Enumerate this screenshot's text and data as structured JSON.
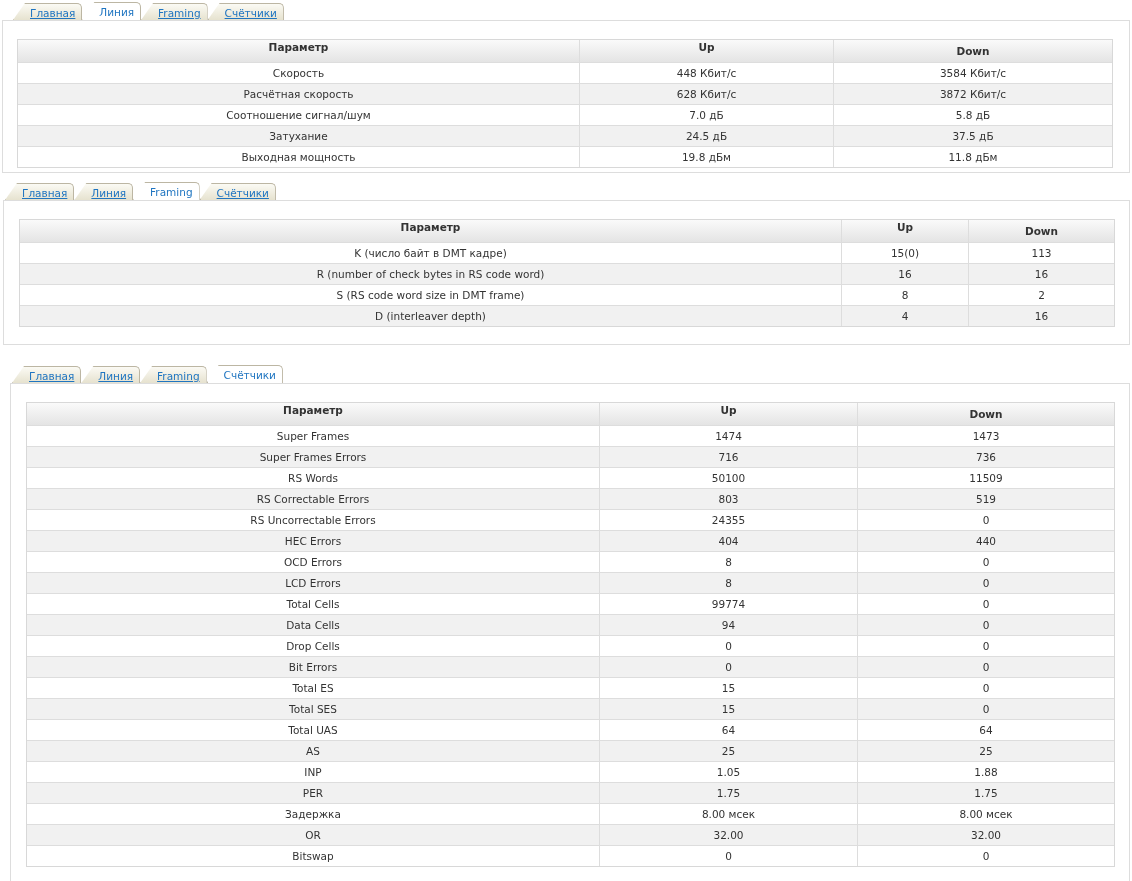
{
  "panels": [
    {
      "tabs": [
        {
          "label": "Главная",
          "selected": false
        },
        {
          "label": "Линия",
          "selected": true
        },
        {
          "label": "Framing",
          "selected": false
        },
        {
          "label": "Счётчики",
          "selected": false
        }
      ],
      "columns": [
        "Параметр",
        "Up",
        "Down"
      ],
      "rows": [
        [
          "Скорость",
          "448 Кбит/с",
          "3584 Кбит/с"
        ],
        [
          "Расчётная скорость",
          "628 Кбит/с",
          "3872 Кбит/с"
        ],
        [
          "Соотношение сигнал/шум",
          "7.0 дБ",
          "5.8 дБ"
        ],
        [
          "Затухание",
          "24.5 дБ",
          "37.5 дБ"
        ],
        [
          "Выходная мощность",
          "19.8 дБм",
          "11.8 дБм"
        ]
      ]
    },
    {
      "tabs": [
        {
          "label": "Главная",
          "selected": false
        },
        {
          "label": "Линия",
          "selected": false
        },
        {
          "label": "Framing",
          "selected": true
        },
        {
          "label": "Счётчики",
          "selected": false
        }
      ],
      "columns": [
        "Параметр",
        "Up",
        "Down"
      ],
      "rows": [
        [
          "K (число байт в DMT кадре)",
          "15(0)",
          "113"
        ],
        [
          "R (number of check bytes in RS code word)",
          "16",
          "16"
        ],
        [
          "S (RS code word size in DMT frame)",
          "8",
          "2"
        ],
        [
          "D (interleaver depth)",
          "4",
          "16"
        ]
      ]
    },
    {
      "tabs": [
        {
          "label": "Главная",
          "selected": false
        },
        {
          "label": "Линия",
          "selected": false
        },
        {
          "label": "Framing",
          "selected": false
        },
        {
          "label": "Счётчики",
          "selected": true
        }
      ],
      "columns": [
        "Параметр",
        "Up",
        "Down"
      ],
      "rows": [
        [
          "Super Frames",
          "1474",
          "1473"
        ],
        [
          "Super Frames Errors",
          "716",
          "736"
        ],
        [
          "RS Words",
          "50100",
          "11509"
        ],
        [
          "RS Correctable Errors",
          "803",
          "519"
        ],
        [
          "RS Uncorrectable Errors",
          "24355",
          "0"
        ],
        [
          "HEC Errors",
          "404",
          "440"
        ],
        [
          "OCD Errors",
          "8",
          "0"
        ],
        [
          "LCD Errors",
          "8",
          "0"
        ],
        [
          "Total Cells",
          "99774",
          "0"
        ],
        [
          "Data Cells",
          "94",
          "0"
        ],
        [
          "Drop Cells",
          "0",
          "0"
        ],
        [
          "Bit Errors",
          "0",
          "0"
        ],
        [
          "Total ES",
          "15",
          "0"
        ],
        [
          "Total SES",
          "15",
          "0"
        ],
        [
          "Total UAS",
          "64",
          "64"
        ],
        [
          "AS",
          "25",
          "25"
        ],
        [
          "INP",
          "1.05",
          "1.88"
        ],
        [
          "PER",
          "1.75",
          "1.75"
        ],
        [
          "Задержка",
          "8.00 мсек",
          "8.00 мсек"
        ],
        [
          "OR",
          "32.00",
          "32.00"
        ],
        [
          "Bitswap",
          "0",
          "0"
        ]
      ]
    }
  ]
}
